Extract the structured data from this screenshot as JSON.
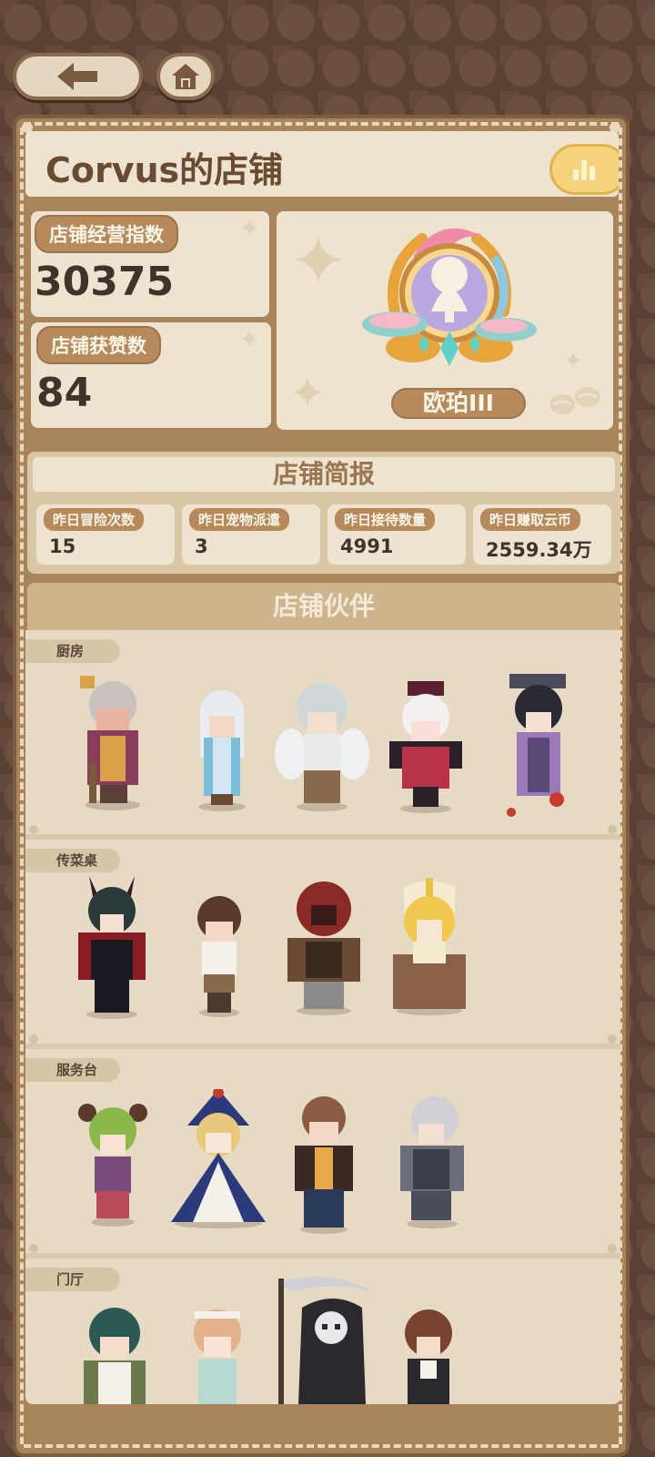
{
  "nav": {
    "back_icon": "arrow-left-icon",
    "home_icon": "home-icon"
  },
  "shop": {
    "title": "Corvus的店铺",
    "rank_icon": "bar-chart-icon",
    "stats": [
      {
        "label": "店铺经营指数",
        "value": "30375"
      },
      {
        "label": "店铺获赞数",
        "value": "84"
      }
    ],
    "badge": {
      "name": "欧珀III",
      "icon": "tree-emblem-icon"
    }
  },
  "report": {
    "title": "店铺简报",
    "items": [
      {
        "label": "昨日冒险次数",
        "value": "15"
      },
      {
        "label": "昨日宠物派遣",
        "value": "3"
      },
      {
        "label": "昨日接待数量",
        "value": "4991"
      },
      {
        "label": "昨日赚取云币",
        "value": "2559.34万"
      }
    ]
  },
  "partners": {
    "title": "店铺伙伴",
    "sections": [
      {
        "name": "厨房",
        "characters": [
          "chef-old-woman",
          "white-hair-kimono-girl",
          "winged-elf",
          "horned-red-girl",
          "dark-crowned-lady"
        ]
      },
      {
        "name": "传菜桌",
        "characters": [
          "red-armored-demon",
          "brown-hair-boy",
          "red-demon-warrior",
          "blonde-priestess"
        ]
      },
      {
        "name": "服务台",
        "characters": [
          "green-hair-girl",
          "blue-hood-mage",
          "brown-jacket-man",
          "silver-armored-knight"
        ]
      },
      {
        "name": "门厅",
        "characters": [
          "teal-hair-girl",
          "pink-hair-girl",
          "grim-reaper",
          "brown-hair-lady"
        ]
      }
    ]
  },
  "colors": {
    "frame": "#a8845a",
    "card": "#eee3cf",
    "pill": "#b78a5c",
    "text_dark": "#3f342b",
    "accent": "#f6d27a"
  }
}
